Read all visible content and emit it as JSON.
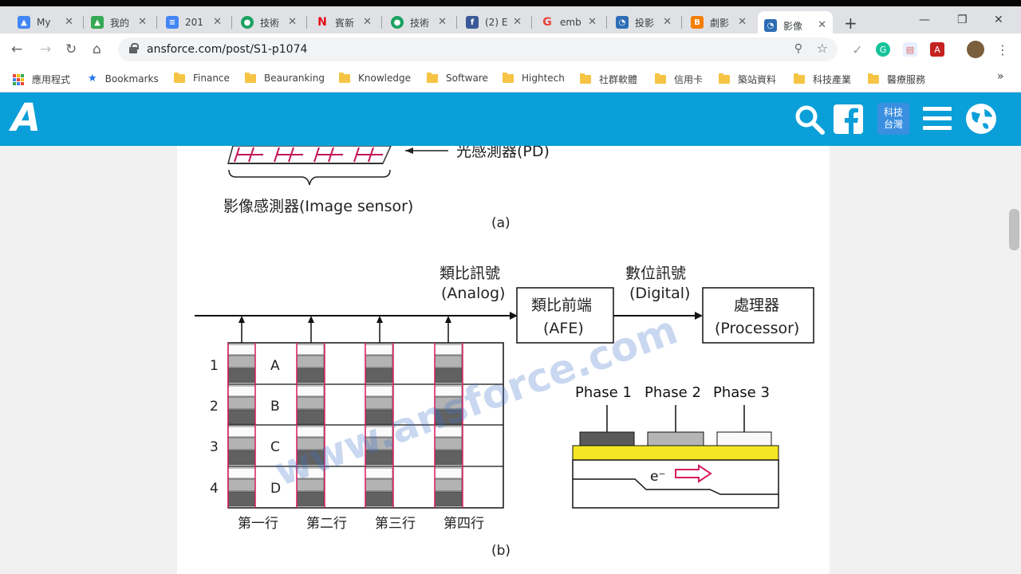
{
  "tabs": [
    {
      "title": "My",
      "icon": "google-drive-icon",
      "color": "#4285f4"
    },
    {
      "title": "我的",
      "icon": "google-drive-icon",
      "color": "#34a853"
    },
    {
      "title": "201",
      "icon": "docs-icon",
      "color": "#4285f4"
    },
    {
      "title": "技術",
      "icon": "green-circle-icon",
      "color": "#1aa260"
    },
    {
      "title": "賓新",
      "icon": "netflix-n-icon",
      "color": "#e50914"
    },
    {
      "title": "技術",
      "icon": "green-circle-icon",
      "color": "#1aa260"
    },
    {
      "title": "(2) E",
      "icon": "facebook-icon",
      "color": "#3b5998"
    },
    {
      "title": "emb",
      "icon": "google-g-icon",
      "color": "#ea4335"
    },
    {
      "title": "投影",
      "icon": "rss-icon",
      "color": "#2c6db5"
    },
    {
      "title": "劇影",
      "icon": "blogger-icon",
      "color": "#f57d00"
    },
    {
      "title": "影像",
      "icon": "rss-icon",
      "color": "#2c6db5"
    }
  ],
  "address": {
    "url": "ansforce.com/post/S1-p1074"
  },
  "bookmarks": {
    "apps_label": "應用程式",
    "items": [
      "Bookmarks",
      "Finance",
      "Beauranking",
      "Knowledge",
      "Software",
      "Hightech",
      "社群軟體",
      "信用卡",
      "築站資料",
      "科技產業",
      "醫療服務"
    ],
    "more": "»"
  },
  "site": {
    "logo": "A",
    "badge_line1": "科技",
    "badge_line2": "台灣",
    "brand_color": "#0a9fd8"
  },
  "figure": {
    "top_label_pd": "光感測器(PD)",
    "top_label_sensor": "影像感測器(Image sensor)",
    "caption_a": "(a)",
    "analog_zh": "類比訊號",
    "analog_en": "(Analog)",
    "afe_zh": "類比前端",
    "afe_en": "(AFE)",
    "digital_zh": "數位訊號",
    "digital_en": "(Digital)",
    "proc_zh": "處理器",
    "proc_en": "(Processor)",
    "rows": [
      "1",
      "2",
      "3",
      "4"
    ],
    "row_letters": [
      "A",
      "B",
      "C",
      "D"
    ],
    "columns": [
      "第一行",
      "第二行",
      "第三行",
      "第四行"
    ],
    "phases": [
      "Phase 1",
      "Phase 2",
      "Phase 3"
    ],
    "electron": "e⁻",
    "watermark": "www.ansforce.com",
    "caption_b": "(b)"
  }
}
